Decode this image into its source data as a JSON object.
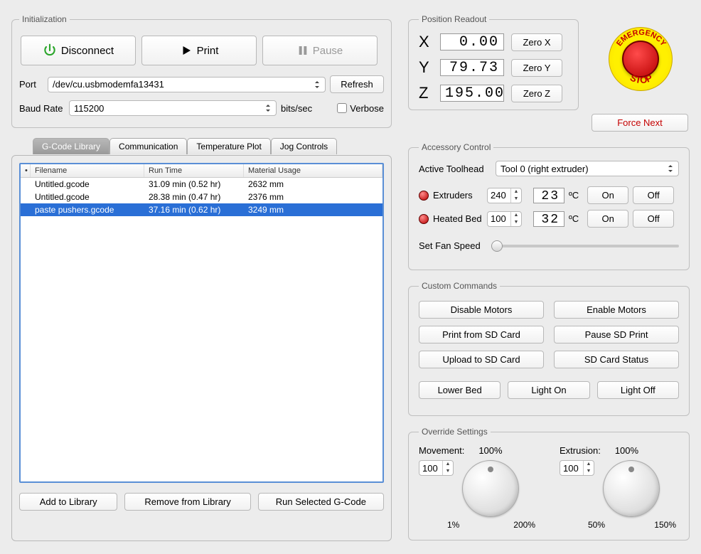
{
  "initialization": {
    "legend": "Initialization",
    "disconnect": "Disconnect",
    "print": "Print",
    "pause": "Pause",
    "port_label": "Port",
    "port_value": "/dev/cu.usbmodemfa13431",
    "refresh": "Refresh",
    "baud_label": "Baud Rate",
    "baud_value": "115200",
    "baud_unit": "bits/sec",
    "verbose": "Verbose"
  },
  "tabs": {
    "gcode": "G-Code Library",
    "comm": "Communication",
    "temp": "Temperature Plot",
    "jog": "Jog Controls"
  },
  "library": {
    "headers": {
      "filename": "Filename",
      "runtime": "Run Time",
      "material": "Material Usage"
    },
    "rows": [
      {
        "filename": "Untitled.gcode",
        "runtime": "31.09 min (0.52 hr)",
        "material": "2632 mm"
      },
      {
        "filename": "Untitled.gcode",
        "runtime": "28.38 min (0.47 hr)",
        "material": "2376 mm"
      },
      {
        "filename": "paste pushers.gcode",
        "runtime": "37.16 min (0.62 hr)",
        "material": "3249 mm"
      }
    ],
    "add": "Add to Library",
    "remove": "Remove from Library",
    "run": "Run Selected G-Code"
  },
  "position": {
    "legend": "Position Readout",
    "x": "0.00",
    "y": "79.73",
    "z": "195.00",
    "zero_x": "Zero X",
    "zero_y": "Zero Y",
    "zero_z": "Zero Z"
  },
  "force_next": "Force Next",
  "accessory": {
    "legend": "Accessory Control",
    "toolhead_label": "Active Toolhead",
    "toolhead_value": "Tool 0 (right extruder)",
    "extruders": "Extruders",
    "extruders_set": "240",
    "extruders_cur": "23",
    "deg": "ºC",
    "bed": "Heated Bed",
    "bed_set": "100",
    "bed_cur": "32",
    "on": "On",
    "off": "Off",
    "fan_label": "Set Fan Speed"
  },
  "custom": {
    "legend": "Custom Commands",
    "disable": "Disable Motors",
    "enable": "Enable Motors",
    "printsd": "Print from SD Card",
    "pausesd": "Pause SD Print",
    "upload": "Upload to SD Card",
    "status": "SD Card Status",
    "lower": "Lower Bed",
    "lighton": "Light On",
    "lightoff": "Light Off"
  },
  "override": {
    "legend": "Override Settings",
    "movement": "Movement:",
    "movement_pct": "100%",
    "movement_val": "100",
    "movement_min": "1%",
    "movement_max": "200%",
    "extrusion": "Extrusion:",
    "extrusion_pct": "100%",
    "extrusion_val": "100",
    "extrusion_min": "50%",
    "extrusion_max": "150%"
  },
  "estop": {
    "top": "EMERGENCY",
    "bottom": "STOP"
  }
}
